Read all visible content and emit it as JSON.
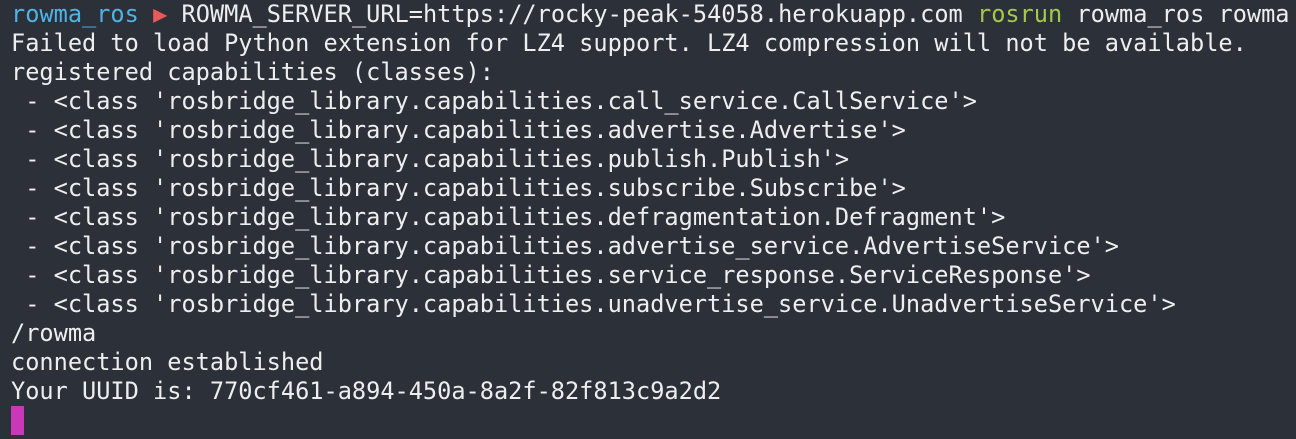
{
  "prompt": {
    "user": "rowma_ros",
    "arrow": "▶",
    "env": "ROWMA_SERVER_URL=https://rocky-peak-54058.herokuapp.com",
    "command": "rosrun",
    "args": "rowma_ros rowma"
  },
  "output": [
    "Failed to load Python extension for LZ4 support. LZ4 compression will not be available.",
    "registered capabilities (classes):",
    " - <class 'rosbridge_library.capabilities.call_service.CallService'>",
    " - <class 'rosbridge_library.capabilities.advertise.Advertise'>",
    " - <class 'rosbridge_library.capabilities.publish.Publish'>",
    " - <class 'rosbridge_library.capabilities.subscribe.Subscribe'>",
    " - <class 'rosbridge_library.capabilities.defragmentation.Defragment'>",
    " - <class 'rosbridge_library.capabilities.advertise_service.AdvertiseService'>",
    " - <class 'rosbridge_library.capabilities.service_response.ServiceResponse'>",
    " - <class 'rosbridge_library.capabilities.unadvertise_service.UnadvertiseService'>",
    "/rowma",
    "connection established",
    "Your UUID is: 770cf461-a894-450a-8a2f-82f813c9a2d2"
  ],
  "colors": {
    "background": "#2b3039",
    "text": "#eeeeee",
    "prompt_user": "#4fb3e6",
    "prompt_arrow": "#e85a5a",
    "command": "#a6c84a",
    "cursor": "#c838b8"
  }
}
